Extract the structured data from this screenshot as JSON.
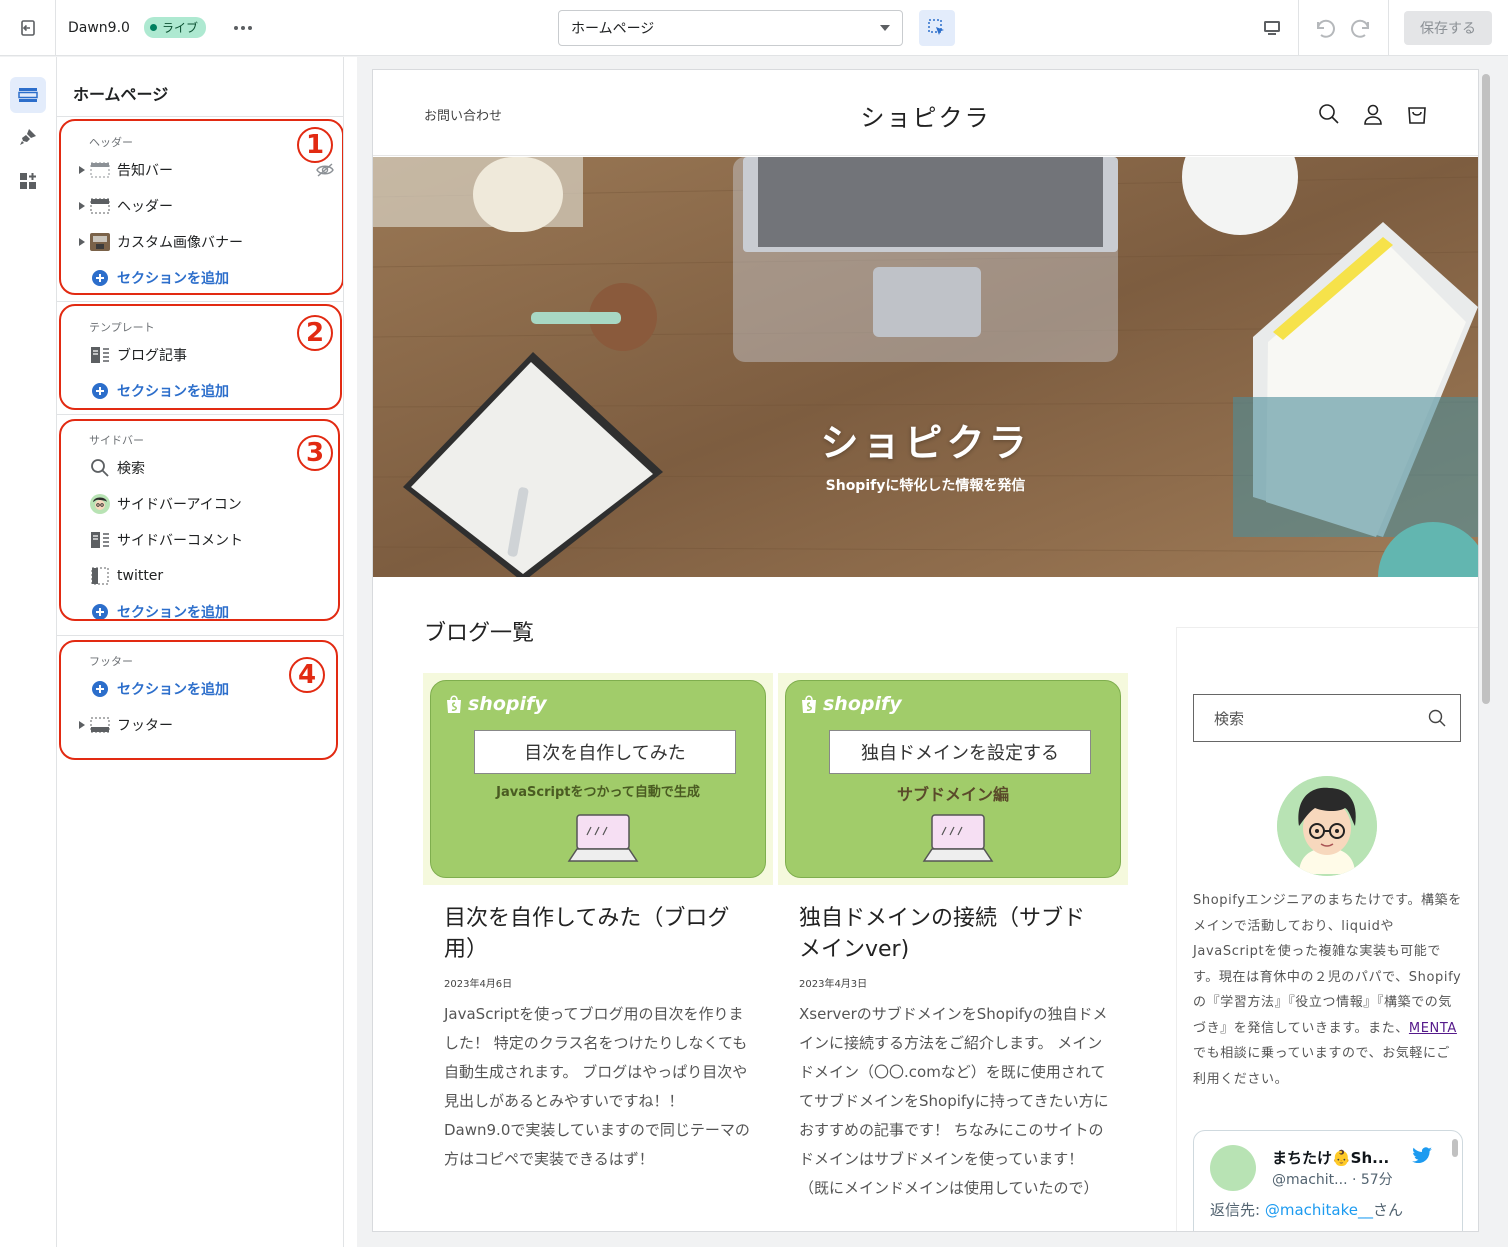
{
  "topbar": {
    "theme_name": "Dawn9.0",
    "live_badge": "ライブ",
    "page_select": "ホームページ",
    "save_label": "保存する"
  },
  "panel": {
    "title": "ホームページ",
    "groups": [
      {
        "title": "ヘッダー",
        "number": "1",
        "items": [
          {
            "label": "告知バー",
            "icon": "section-icon",
            "hidden": true
          },
          {
            "label": "ヘッダー",
            "icon": "section-icon"
          },
          {
            "label": "カスタム画像バナー",
            "icon": "image-thumb-icon"
          }
        ],
        "add_label": "セクションを追加"
      },
      {
        "title": "テンプレート",
        "number": "2",
        "items": [
          {
            "label": "ブログ記事",
            "icon": "blog-post-icon"
          }
        ],
        "add_label": "セクションを追加"
      },
      {
        "title": "サイドバー",
        "number": "3",
        "items": [
          {
            "label": "検索",
            "icon": "search-icon"
          },
          {
            "label": "サイドバーアイコン",
            "icon": "avatar-icon"
          },
          {
            "label": "サイドバーコメント",
            "icon": "blog-post-icon"
          },
          {
            "label": "twitter",
            "icon": "sidebar-section-icon"
          }
        ],
        "add_label": "セクションを追加"
      },
      {
        "title": "フッター",
        "number": "4",
        "items": [
          {
            "label": "フッター",
            "icon": "section-icon"
          }
        ],
        "add_label": "セクションを追加"
      }
    ]
  },
  "preview": {
    "contact": "お問い合わせ",
    "logo": "ショピクラ",
    "hero_title": "ショピクラ",
    "hero_subtitle": "Shopifyに特化した情報を発信",
    "blog_heading": "ブログ一覧",
    "cards": [
      {
        "thumb_logo": "shopify",
        "thumb_title": "目次を自作してみた",
        "thumb_sub": "JavaScriptをつかって自動で生成",
        "title": "目次を自作してみた（ブログ用）",
        "date": "2023年4月6日",
        "excerpt": "JavaScriptを使ってブログ用の目次を作りました！ 特定のクラス名をつけたりしなくても自動生成されます。 ブログはやっぱり目次や見出しがあるとみやすいですね！！ Dawn9.0で実装していますので同じテーマの方はコピペで実装できるはず！"
      },
      {
        "thumb_logo": "shopify",
        "thumb_title": "独自ドメインを設定する",
        "thumb_sub": "サブドメイン編",
        "title": "独自ドメインの接続（サブドメインver)",
        "date": "2023年4月3日",
        "excerpt": "XserverのサブドメインをShopifyの独自ドメインに接続する方法をご紹介します。 メインドメイン（〇〇.comなど）を既に使用されててサブドメインをShopifyに持ってきたい方におすすめの記事です！ ちなみにこのサイトのドメインはサブドメインを使っています！（既にメインドメインは使用していたので）"
      }
    ],
    "sidebar": {
      "search_placeholder": "検索",
      "bio_before": "Shopifyエンジニアのまちたけです。構築をメインで活動しており、liquidやJavaScriptを使った複雑な実装も可能です。現在は育休中の２児のパパで、Shopifyの『学習方法』『役立つ情報』『構築での気づき』を発信していきます。また、",
      "bio_link": "MENTA",
      "bio_after": "でも相談に乗っていますので、お気軽にご利用ください。",
      "tweet": {
        "name": "まちたけ👶Sh...",
        "handle": "@machit... · 57分",
        "reply_prefix": "返信先: ",
        "reply_handle": "@machitake__",
        "reply_suffix": "さん"
      }
    }
  },
  "colors": {
    "accent": "#2c6ecb",
    "annotation_red": "#e22a12",
    "live_green": "#aee9d1",
    "thumb_green": "#a1cc6a"
  }
}
